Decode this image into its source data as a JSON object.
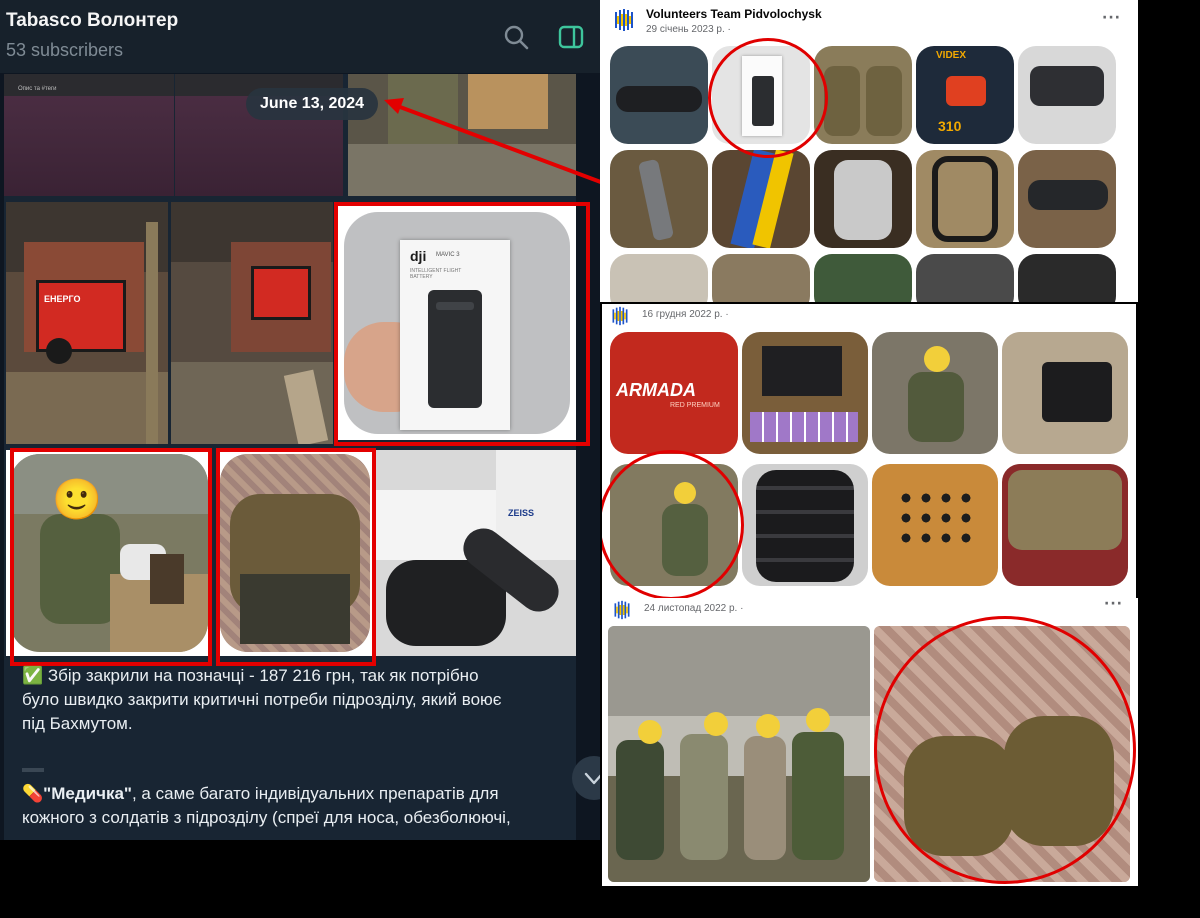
{
  "telegram": {
    "channel_title": "Tabasco Волонтер",
    "subscribers": "53 subscribers",
    "date_badge": "June 13, 2024",
    "mini_label": "Опис та #теги",
    "box_brand": "dji",
    "box_model": "MAVIC 3",
    "box_caption": "INTELLIGENT FLIGHT BATTERY",
    "generator_brand": "ЕНЕРГО",
    "zeiss": "ZEISS",
    "message_lines": [
      "✅ Збір закрили на позначці - 187 216 грн, так як потрібно",
      "було швидко закрити критичні потреби підрозділу, який воює",
      "під Бахмутом."
    ],
    "medic_emoji": "💊",
    "medic_title": "\"Медичка\"",
    "medic_rest": ", а саме багато індивідуальних препаратів для",
    "medic_line2": "кожного з солдатів з підрозділу (спреї для носа, обезболюючі,"
  },
  "facebook": {
    "page_name": "Volunteers Team Pidvolochysk",
    "post1_date": "29 січень 2023 р. · ",
    "post2_date": "16 грудня 2022 р. · ",
    "post3_date": "24 листопад 2022 р. · ",
    "more": "···",
    "armada": "ARMADA",
    "armada_sub": "RED PREMIUM",
    "videx": "VIDEX",
    "lamp_number": "310"
  },
  "colors": {
    "telegram_bg": "#17212b",
    "highlight_red": "#e30000",
    "facebook_bg": "#ffffff"
  }
}
